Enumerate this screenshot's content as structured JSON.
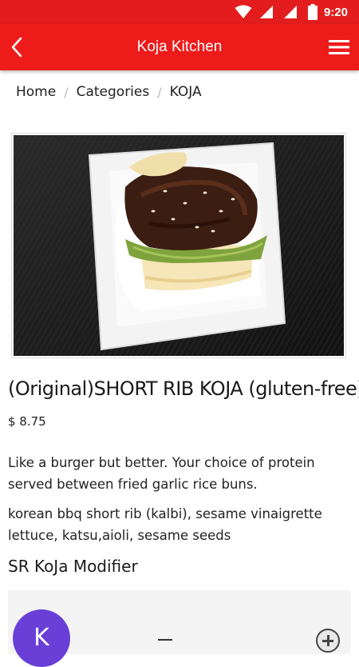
{
  "status_bar": {
    "time": "9:20"
  },
  "app_bar": {
    "title": "Koja Kitchen",
    "back_icon": "chevron-left-icon",
    "menu_icon": "hamburger-menu-icon"
  },
  "breadcrumb": {
    "home": "Home",
    "categories": "Categories",
    "current": "KOJA",
    "separator": "/"
  },
  "product": {
    "title": "(Original)SHORT RIB KOJA (gluten-free)",
    "price": "$ 8.75",
    "description": "Like a burger but better. Your choice of protein served between fried garlic rice buns.",
    "ingredients": "korean bbq short rib (kalbi), sesame vinaigrette lettuce, katsu,aioli, sesame seeds"
  },
  "modifier": {
    "heading": "SR KoJa Modifier",
    "avatar_letter": "K",
    "add_icon": "plus-circle-icon"
  },
  "colors": {
    "primary": "#ee1b1b",
    "status_bar": "#e31d1d",
    "avatar": "#6a3fd8"
  }
}
